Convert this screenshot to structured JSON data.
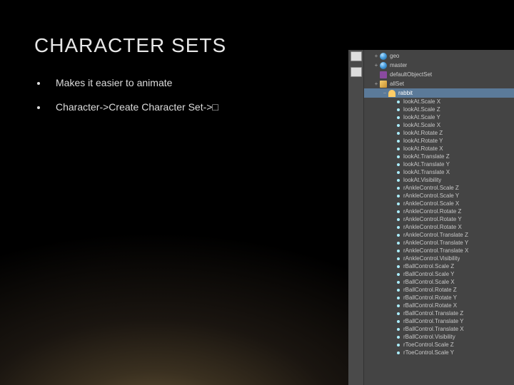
{
  "title": "CHARACTER SETS",
  "bullets": [
    "Makes it easier to animate",
    "Character->Create Character Set->□"
  ],
  "panel": {
    "root_nodes": [
      {
        "label": "geo",
        "icon": "globe",
        "twisty": "+"
      },
      {
        "label": "master",
        "icon": "globe",
        "twisty": "+"
      },
      {
        "label": "defaultObjectSet",
        "icon": "layer",
        "twisty": ""
      },
      {
        "label": "allSet",
        "icon": "set",
        "twisty": "+"
      }
    ],
    "sel_node": {
      "label": "rabbit",
      "icon": "human",
      "twisty": "−"
    },
    "attrs": [
      "lookAt.Scale X",
      "lookAt.Scale Z",
      "lookAt.Scale Y",
      "lookAt.Scale X",
      "lookAt.Rotate Z",
      "lookAt.Rotate Y",
      "lookAt.Rotate X",
      "lookAt.Translate Z",
      "lookAt.Translate Y",
      "lookAt.Translate X",
      "lookAt.Visibility",
      "rAnkleControl.Scale Z",
      "rAnkleControl.Scale Y",
      "rAnkleControl.Scale X",
      "rAnkleControl.Rotate Z",
      "rAnkleControl.Rotate Y",
      "rAnkleControl.Rotate X",
      "rAnkleControl.Translate Z",
      "rAnkleControl.Translate Y",
      "rAnkleControl.Translate X",
      "rAnkleControl.Visibility",
      "rBallControl.Scale Z",
      "rBallControl.Scale Y",
      "rBallControl.Scale X",
      "rBallControl.Rotate Z",
      "rBallControl.Rotate Y",
      "rBallControl.Rotate X",
      "rBallControl.Translate Z",
      "rBallControl.Translate Y",
      "rBallControl.Translate X",
      "rBallControl.Visibility",
      "rToeControl.Scale Z",
      "rToeControl.Scale Y"
    ]
  }
}
